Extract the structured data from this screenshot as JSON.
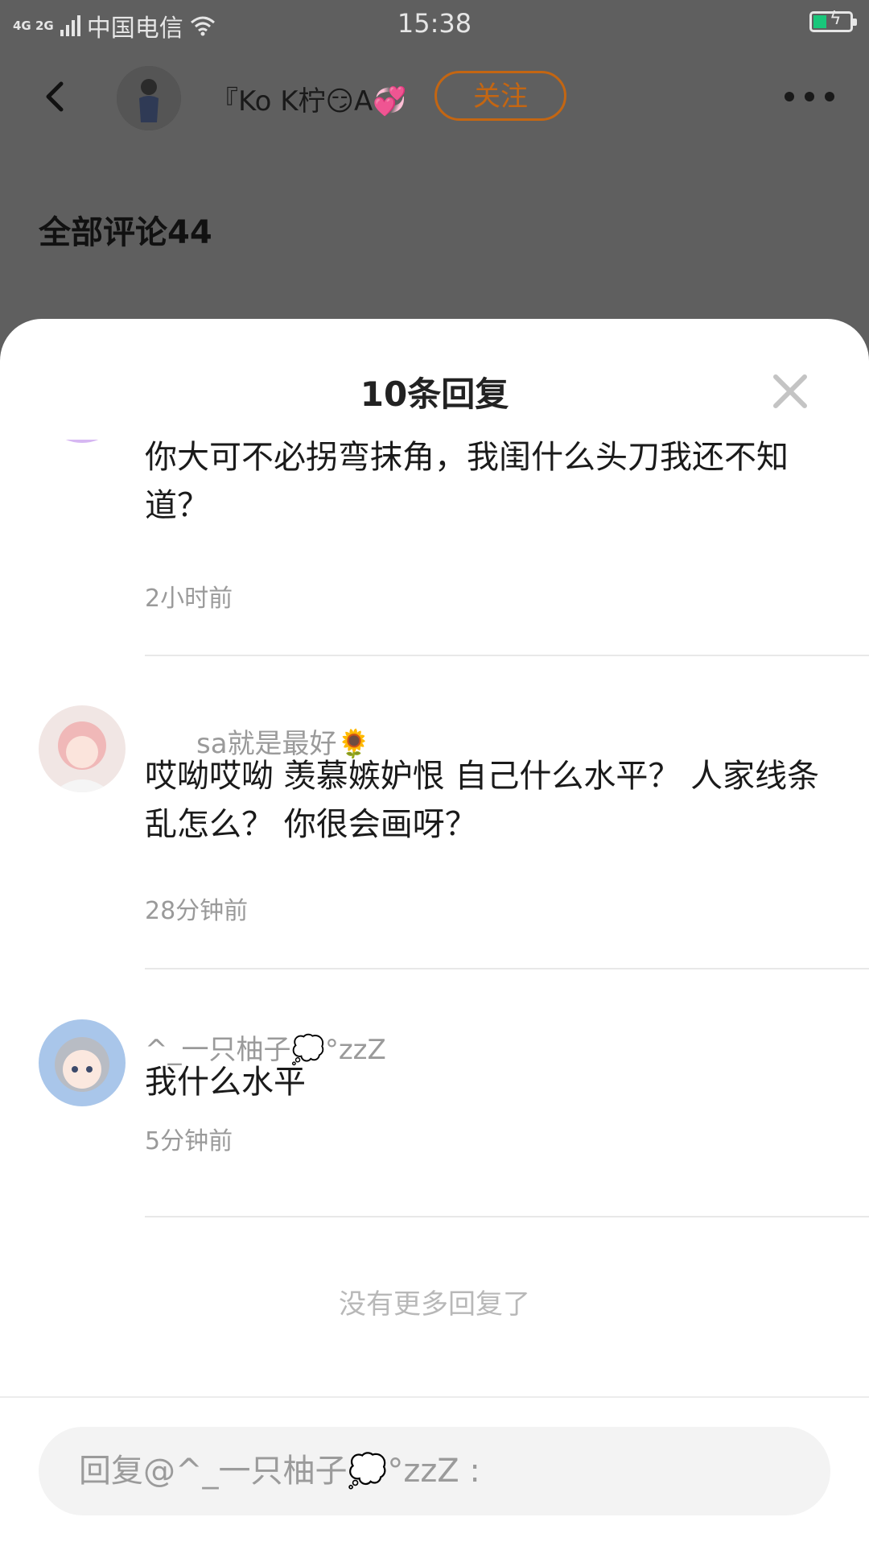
{
  "status_bar": {
    "network": "4G 2G",
    "carrier": "中国电信",
    "time": "15:38"
  },
  "header": {
    "username": "『Ko K柠😏A💞",
    "follow_label": "关注"
  },
  "comments_header": "全部评论44",
  "sheet": {
    "title": "10条回复",
    "replies": [
      {
        "username": "",
        "text": "你大可不必拐弯抹角，我闺什么头刀我还不知道？",
        "time": "2小时前"
      },
      {
        "username": "sa就是最好🌻",
        "text": "哎呦哎呦 羡慕嫉妒恨 自己什么水平？ 人家线条乱怎么？ 你很会画呀？",
        "time": "28分钟前"
      },
      {
        "username": "^_一只柚子💭°zzZ",
        "text": "我什么水平",
        "time": "5分钟前"
      }
    ],
    "no_more": "没有更多回复了"
  },
  "reply_box": {
    "placeholder": "回复@^_一只柚子💭°zzZ :"
  },
  "colors": {
    "accent": "#c46612",
    "overlay": "#5f5f5f",
    "battery": "#19c77b"
  }
}
